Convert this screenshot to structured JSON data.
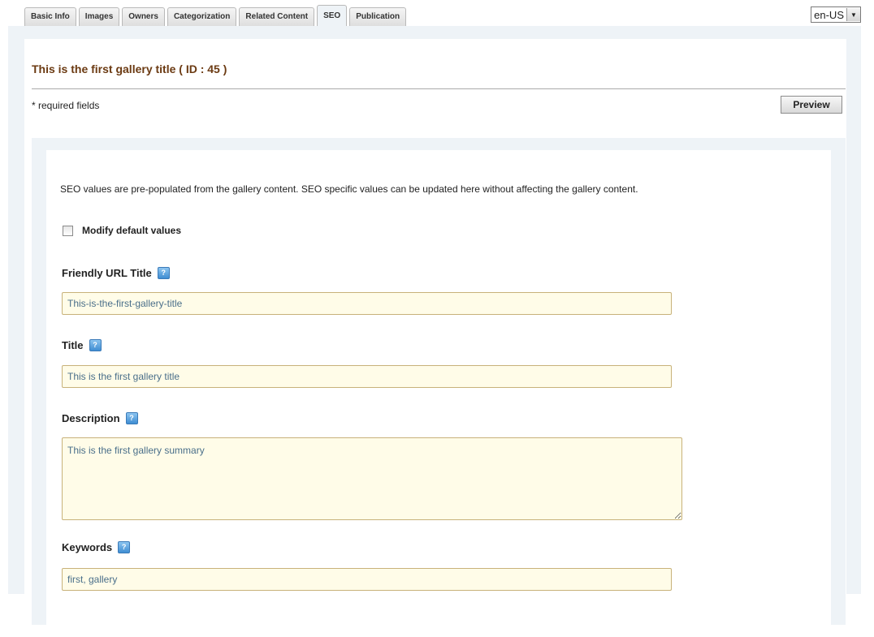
{
  "tabs": [
    {
      "label": "Basic Info",
      "active": false
    },
    {
      "label": "Images",
      "active": false
    },
    {
      "label": "Owners",
      "active": false
    },
    {
      "label": "Categorization",
      "active": false
    },
    {
      "label": "Related Content",
      "active": false
    },
    {
      "label": "SEO",
      "active": true
    },
    {
      "label": "Publication",
      "active": false
    }
  ],
  "language": {
    "selected": "en-US",
    "icon": "chevron-down-icon"
  },
  "header": {
    "title": "This is the first gallery title ( ID : 45 )",
    "required_note": "* required fields",
    "preview_label": "Preview"
  },
  "seo": {
    "intro": "SEO values are pre-populated from the gallery content. SEO specific values can be updated here without affecting the gallery content.",
    "modify_label": "Modify default values",
    "modify_checked": false,
    "fields": {
      "friendly_url": {
        "label": "Friendly URL Title",
        "value": "This-is-the-first-gallery-title"
      },
      "title": {
        "label": "Title",
        "value": "This is the first gallery title"
      },
      "description": {
        "label": "Description",
        "value": "This is the first gallery summary"
      },
      "keywords": {
        "label": "Keywords",
        "value": "first, gallery"
      }
    },
    "help_icon": "?"
  },
  "colors": {
    "title_brown": "#6b3a12",
    "panel_bg": "#eef3f7",
    "input_bg": "#fffce8",
    "input_text": "#4a6f8a",
    "help_blue": "#3f8ed2"
  }
}
